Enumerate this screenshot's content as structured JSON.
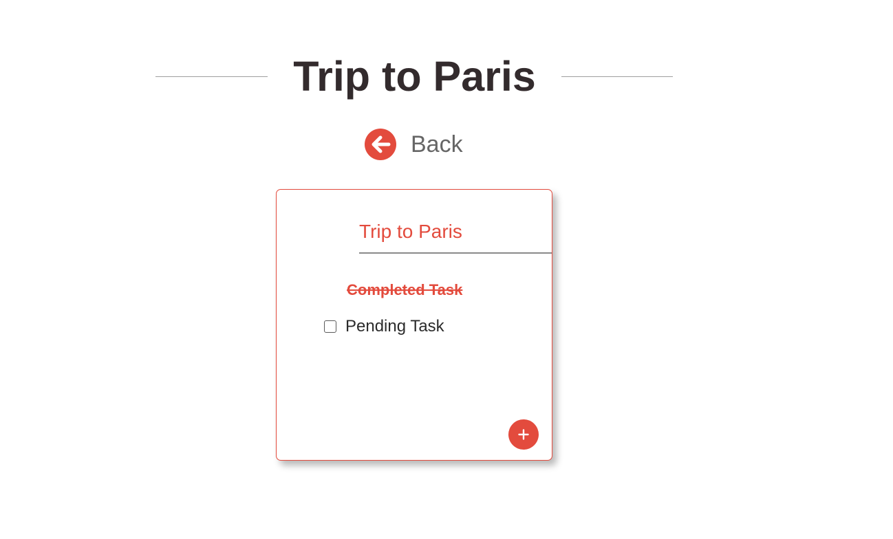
{
  "page": {
    "title": "Trip to Paris"
  },
  "back": {
    "label": "Back",
    "icon": "arrow-left-circle-icon"
  },
  "card": {
    "title_value": "Trip to Paris",
    "tasks": [
      {
        "label": "Completed Task",
        "completed": true
      },
      {
        "label": "Pending Task",
        "completed": false
      }
    ],
    "add_icon": "plus-icon"
  },
  "colors": {
    "accent": "#e34b3d",
    "title_text": "#332b2d",
    "muted_text": "#666666",
    "rule": "#9e9e9e"
  }
}
